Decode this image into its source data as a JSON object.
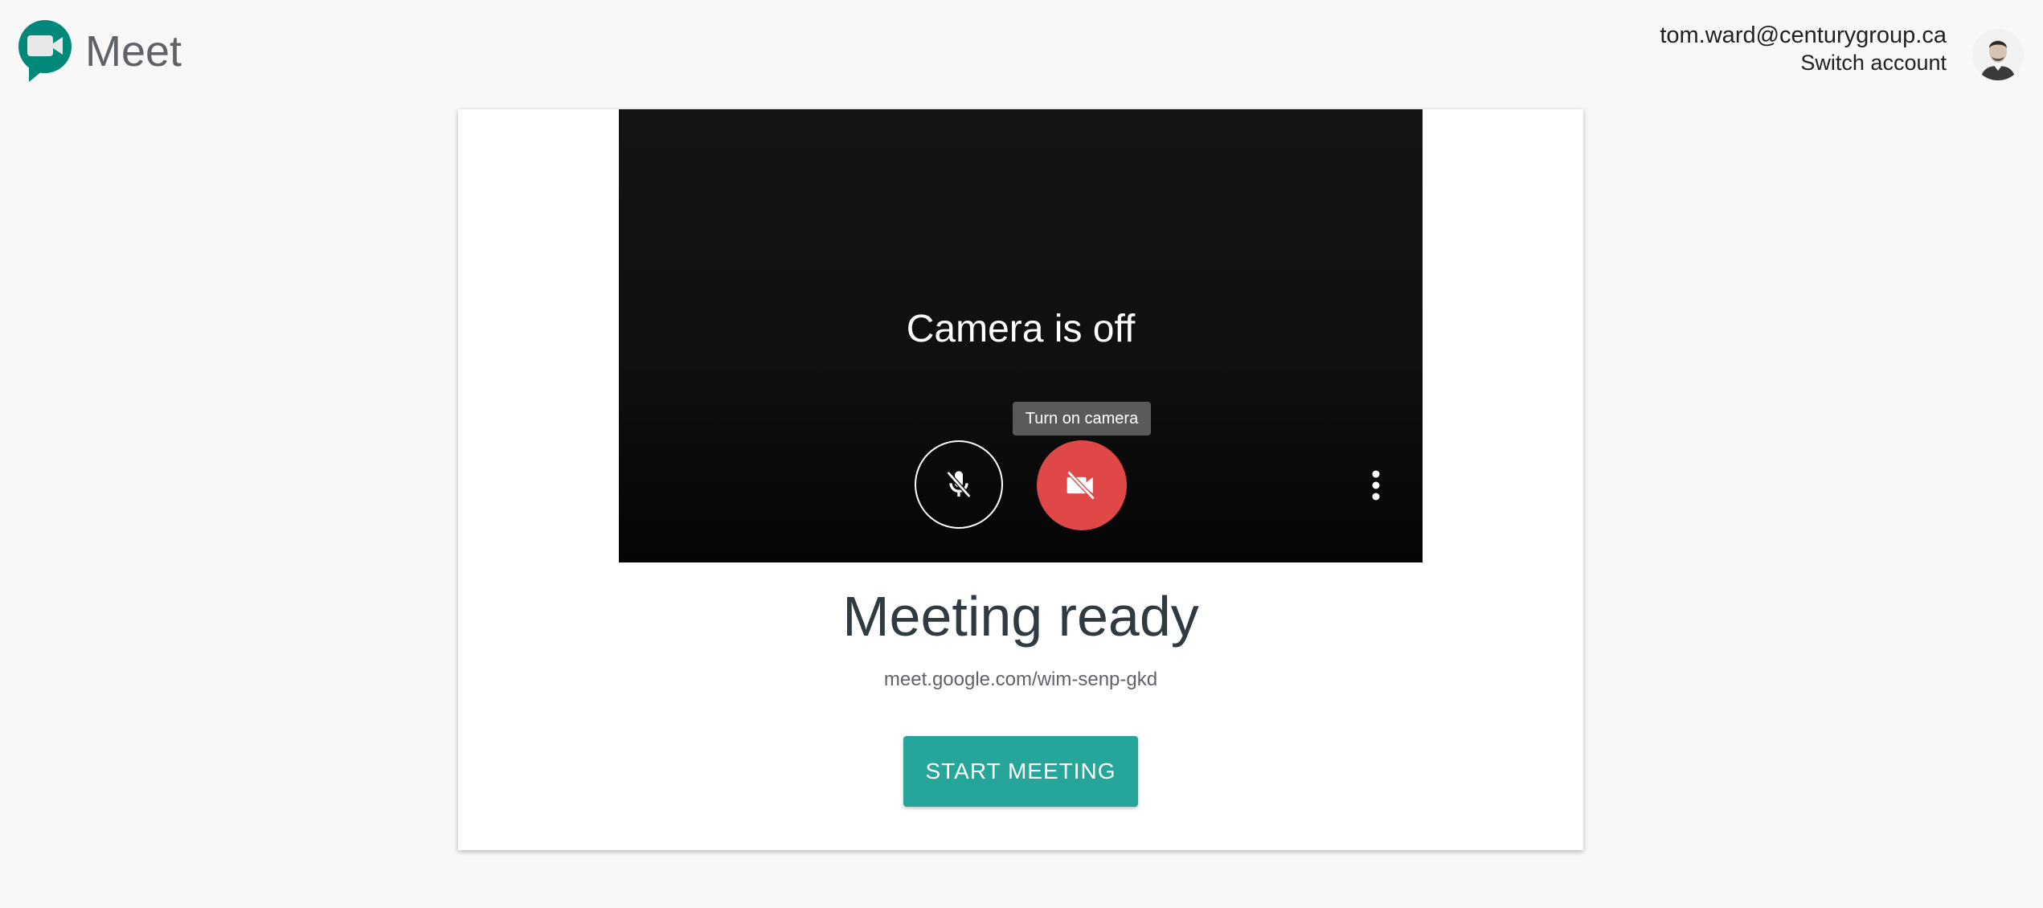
{
  "app": {
    "name": "Meet",
    "brand_color": "#00897b"
  },
  "account": {
    "email": "tom.ward@centurygroup.ca",
    "switch_label": "Switch account"
  },
  "preview": {
    "status_text": "Camera is off",
    "tooltip": "Turn on camera",
    "mic_state": "muted",
    "camera_state": "off",
    "camera_button_color": "#e04848"
  },
  "meeting": {
    "title": "Meeting ready",
    "link": "meet.google.com/wim-senp-gkd",
    "start_label": "START MEETING",
    "start_color": "#26a69a"
  },
  "icons": {
    "logo": "meet-camera-logo-icon",
    "mic": "mic-off-icon",
    "camera": "videocam-off-icon",
    "more": "more-vert-icon",
    "avatar": "avatar-photo"
  }
}
